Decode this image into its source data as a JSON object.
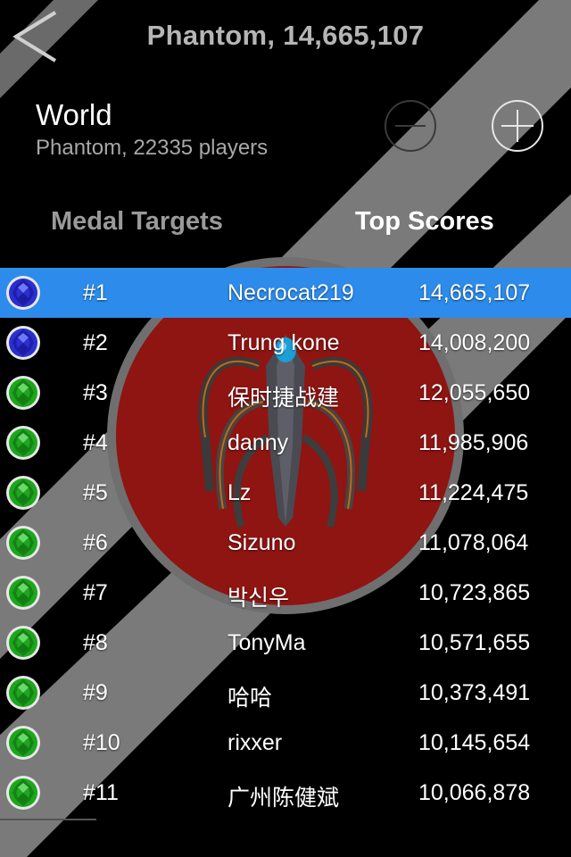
{
  "header": {
    "title": "Phantom, 14,665,107"
  },
  "board": {
    "title": "World",
    "subtitle": "Phantom, 22335 players"
  },
  "tabs": [
    {
      "label": "Medal Targets",
      "active": false
    },
    {
      "label": "Top Scores",
      "active": true
    }
  ],
  "colors": {
    "highlight": "#2d8ceb",
    "emblem_red": "#8e1512",
    "stripe": "#7f7f7f"
  },
  "entries": [
    {
      "rank": "#1",
      "name": "Necrocat219",
      "score": "14,665,107",
      "medal": "blue",
      "highlighted": true
    },
    {
      "rank": "#2",
      "name": "Trung kone",
      "score": "14,008,200",
      "medal": "blue",
      "highlighted": false
    },
    {
      "rank": "#3",
      "name": "保时捷战建",
      "score": "12,055,650",
      "medal": "green",
      "highlighted": false
    },
    {
      "rank": "#4",
      "name": "danny",
      "score": "11,985,906",
      "medal": "green",
      "highlighted": false
    },
    {
      "rank": "#5",
      "name": "Lz",
      "score": "11,224,475",
      "medal": "green",
      "highlighted": false
    },
    {
      "rank": "#6",
      "name": "Sizuno",
      "score": "11,078,064",
      "medal": "green",
      "highlighted": false
    },
    {
      "rank": "#7",
      "name": "박신우",
      "score": "10,723,865",
      "medal": "green",
      "highlighted": false
    },
    {
      "rank": "#8",
      "name": "TonyMa",
      "score": "10,571,655",
      "medal": "green",
      "highlighted": false
    },
    {
      "rank": "#9",
      "name": "哈哈",
      "score": "10,373,491",
      "medal": "green",
      "highlighted": false
    },
    {
      "rank": "#10",
      "name": "rixxer",
      "score": "10,145,654",
      "medal": "green",
      "highlighted": false
    },
    {
      "rank": "#11",
      "name": "广州陈健斌",
      "score": "10,066,878",
      "medal": "green",
      "highlighted": false
    }
  ]
}
